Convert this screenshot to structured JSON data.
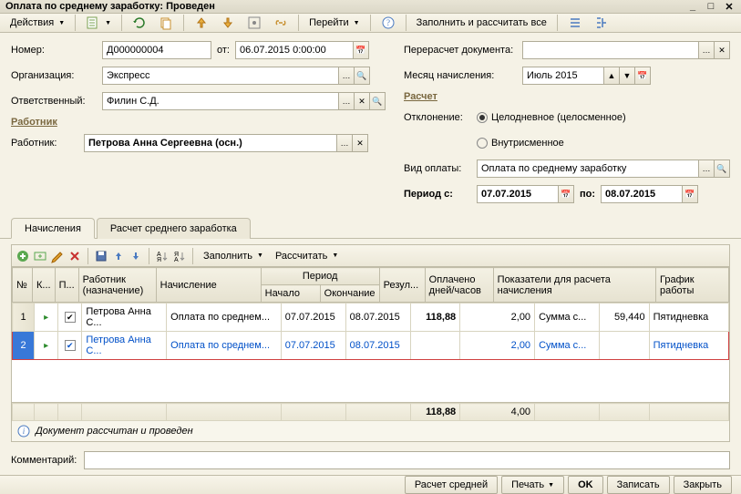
{
  "window": {
    "title": "Оплата по среднему заработку: Проведен"
  },
  "toolbar": {
    "actions": "Действия",
    "go": "Перейти",
    "fill": "Заполнить и рассчитать все"
  },
  "form": {
    "number_label": "Номер:",
    "number": "Д000000004",
    "from_label": "от:",
    "date": "06.07.2015 0:00:00",
    "org_label": "Организация:",
    "org": "Экспресс",
    "resp_label": "Ответственный:",
    "resp": "Филин С.Д.",
    "worker_section": "Работник",
    "worker_label": "Работник:",
    "worker": "Петрова Анна Сергеевна  (осн.)",
    "recalc_label": "Перерасчет документа:",
    "recalc": "",
    "month_label": "Месяц начисления:",
    "month": "Июль 2015",
    "calc_section": "Расчет",
    "deviation_label": "Отклонение:",
    "radio1": "Целодневное (целосменное)",
    "radio2": "Внутрисменное",
    "paytype_label": "Вид оплаты:",
    "paytype": "Оплата по среднему заработку",
    "period_from_label": "Период с:",
    "period_from": "07.07.2015",
    "period_to_label": "по:",
    "period_to": "08.07.2015"
  },
  "tabs": {
    "t1": "Начисления",
    "t2": "Расчет среднего заработка"
  },
  "grid_toolbar": {
    "fill": "Заполнить",
    "calc": "Рассчитать"
  },
  "grid": {
    "h_num": "№",
    "h_k": "К...",
    "h_p": "П...",
    "h_worker": "Работник (назначение)",
    "h_accrual": "Начисление",
    "h_period": "Период",
    "h_start": "Начало",
    "h_end": "Окончание",
    "h_result": "Резул...",
    "h_paid": "Оплачено дней/часов",
    "h_indicators": "Показатели для расчета начисления",
    "h_schedule": "График работы",
    "rows": [
      {
        "n": "1",
        "worker": "Петрова Анна С...",
        "accr": "Оплата по среднем...",
        "start": "07.07.2015",
        "end": "08.07.2015",
        "res": "118,88",
        "paid": "2,00",
        "ind1": "Сумма с...",
        "ind2": "59,440",
        "sched": "Пятидневка"
      },
      {
        "n": "2",
        "worker": "Петрова Анна С...",
        "accr": "Оплата по среднем...",
        "start": "07.07.2015",
        "end": "08.07.2015",
        "res": "",
        "paid": "2,00",
        "ind1": "Сумма с...",
        "ind2": "",
        "sched": "Пятидневка"
      }
    ],
    "sum_res": "118,88",
    "sum_paid": "4,00"
  },
  "status": "Документ рассчитан и проведен",
  "comment_label": "Комментарий:",
  "buttons": {
    "avg": "Расчет средней",
    "print": "Печать",
    "ok": "OK",
    "save": "Записать",
    "close": "Закрыть"
  }
}
